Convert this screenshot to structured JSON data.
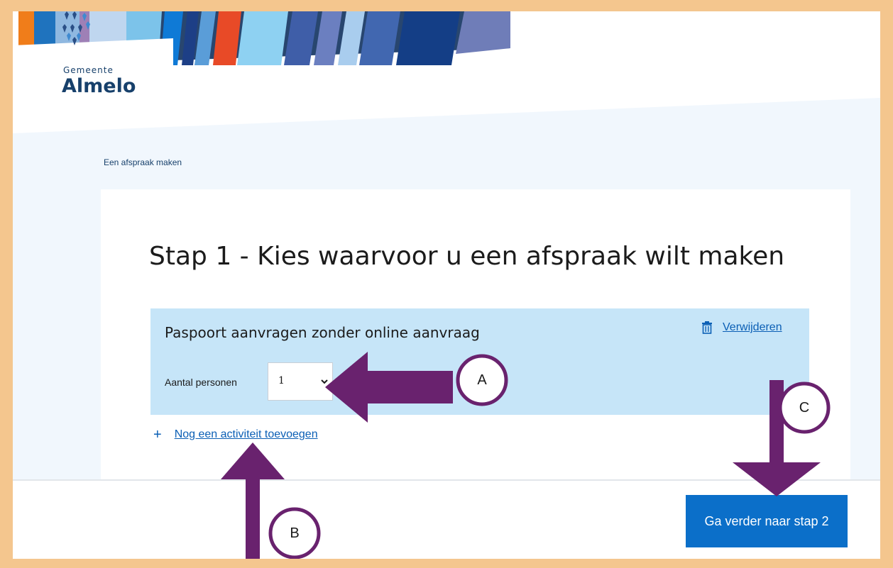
{
  "header": {
    "logo_small": "Gemeente",
    "logo_big": "Almelo"
  },
  "breadcrumb": "Een afspraak maken",
  "page_title": "Stap 1 - Kies waarvoor u een afspraak wilt maken",
  "activity": {
    "title": "Paspoort aanvragen zonder online aanvraag",
    "remove_label": "Verwijderen",
    "remove_icon": "trash-icon",
    "persons_label": "Aantal personen",
    "persons_value": "1"
  },
  "add_activity": {
    "icon": "plus-icon",
    "label": "Nog een activiteit toevoegen"
  },
  "next_button": {
    "label": "Ga verder naar stap 2"
  },
  "annotations": {
    "markers": [
      "A",
      "B",
      "C"
    ],
    "color": "#69226e"
  },
  "colors": {
    "border": "#f4c68e",
    "page_bg": "#f1f7fd",
    "activity_bg": "#c6e5f8",
    "link": "#0b5fb5",
    "button": "#0b6fc9",
    "logo": "#17406b"
  }
}
